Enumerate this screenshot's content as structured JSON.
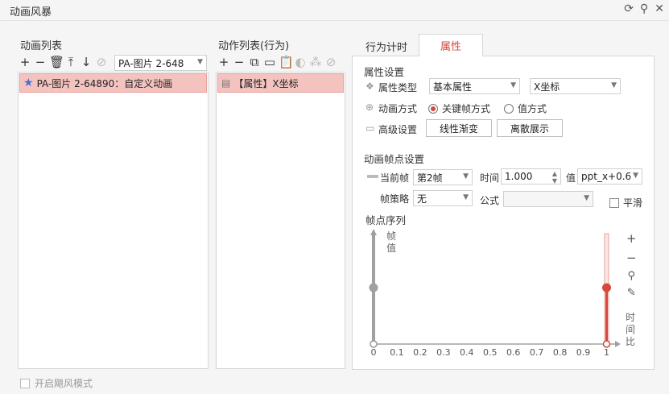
{
  "window": {
    "title": "动画风暴",
    "icons": [
      "refresh-icon",
      "pin-icon",
      "close-icon"
    ]
  },
  "left": {
    "heading": "动画列表",
    "combo_value": "PA-图片 2-648",
    "item_label": "PA-图片 2-64890：自定义动画"
  },
  "middle": {
    "heading": "动作列表(行为)",
    "item_label": "【属性】X坐标"
  },
  "right": {
    "tabs": [
      "行为计时",
      "属性"
    ],
    "active_tab": "属性",
    "section_prop": "属性设置",
    "prop_type_label": "属性类型",
    "prop_type_value": "基本属性",
    "prop_name_value": "X坐标",
    "anim_mode_label": "动画方式",
    "mode_keyframe": "关键帧方式",
    "mode_value": "值方式",
    "advanced_label": "高级设置",
    "btn_linear": "线性渐变",
    "btn_discrete": "离散展示",
    "section_keyframe": "动画帧点设置",
    "cur_frame_label": "当前帧",
    "cur_frame_value": "第2帧",
    "time_label": "时间",
    "time_value": "1.000",
    "val_label": "值",
    "val_value": "ppt_x+0.6",
    "strategy_label": "帧策略",
    "strategy_value": "无",
    "formula_label": "公式",
    "formula_value": "",
    "smooth_label": "平滑",
    "section_seq": "帧点序列",
    "axis_y_label": [
      "帧",
      "值"
    ],
    "axis_x_label": [
      "时",
      "间",
      "比"
    ],
    "x_ticks": [
      "0",
      "0.1",
      "0.2",
      "0.3",
      "0.4",
      "0.5",
      "0.6",
      "0.7",
      "0.8",
      "0.9",
      "1"
    ]
  },
  "footer": {
    "checkbox_label": "开启飓风模式"
  },
  "colors": {
    "accent": "#d5483c",
    "selection": "#f4c3bf"
  }
}
